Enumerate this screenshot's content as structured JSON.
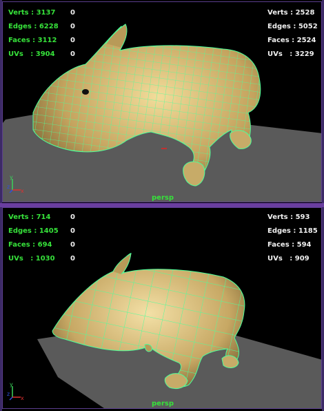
{
  "top_viewport": {
    "left_stats": [
      {
        "label": "Verts : 3137",
        "count": "0"
      },
      {
        "label": "Edges : 6228",
        "count": "0"
      },
      {
        "label": "Faces : 3112",
        "count": "0"
      },
      {
        "label": "UVs   : 3904",
        "count": "0"
      }
    ],
    "right_stats": [
      {
        "label": "Verts : 2528"
      },
      {
        "label": "Edges : 5052"
      },
      {
        "label": "Faces : 2524"
      },
      {
        "label": "UVs   : 3229"
      }
    ],
    "camera": "persp"
  },
  "bottom_viewport": {
    "left_stats": [
      {
        "label": "Verts : 714",
        "count": "0"
      },
      {
        "label": "Edges : 1405",
        "count": "0"
      },
      {
        "label": "Faces : 694",
        "count": "0"
      },
      {
        "label": "UVs   : 1030",
        "count": "0"
      }
    ],
    "right_stats": [
      {
        "label": "Verts : 593"
      },
      {
        "label": "Edges : 1185"
      },
      {
        "label": "Faces : 594"
      },
      {
        "label": "UVs   : 909"
      }
    ],
    "camera": "persp"
  },
  "axis_labels": {
    "x": "x",
    "y": "y",
    "z": "z"
  },
  "colors": {
    "hud_green": "#36e23a",
    "wireframe": "#4dff9a",
    "ground": "#5a5a5a",
    "border": "#6a3ea0"
  }
}
